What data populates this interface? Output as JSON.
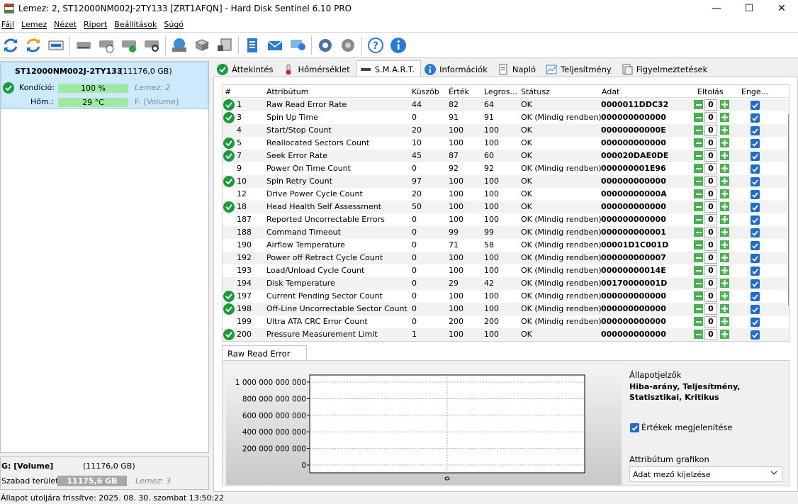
{
  "window": {
    "title": "Lemez: 2, ST12000NM002J-2TY133 [ZRT1AFQN]  -  Hard Disk Sentinel 6.10 PRO",
    "minimize": "—",
    "maximize": "☐",
    "close": "✕"
  },
  "menu": [
    "Fájl",
    "Lemez",
    "Nézet",
    "Riport",
    "Beállítások",
    "Súgó"
  ],
  "disk": {
    "name": "ST12000NM002J-2TY133",
    "size": "(11176,0 GB)",
    "health_label": "Kondíció:",
    "health_value": "100 %",
    "health_pct": 100,
    "disk_ref": "Lemez: 2",
    "temp_label": "Hőm.:",
    "temp_value": "29 °C",
    "volume_ref": "F: [Volume]"
  },
  "volume": {
    "name": "G: [Volume]",
    "size": "(11176,0 GB)",
    "free_label": "Szabad terület",
    "free_value": "11175,6 GB",
    "disk_ref": "Lemez: 3"
  },
  "status_text": "Állapot utoljára frissítve: 2025. 08. 30. szombat 13:50:22",
  "tabs": [
    "Áttekintés",
    "Hőmérséklet",
    "S.M.A.R.T.",
    "Információk",
    "Napló",
    "Teljesítmény",
    "Figyelmeztetések"
  ],
  "active_tab": 2,
  "columns": [
    "#",
    "Attribútum",
    "Küszöb",
    "Érték",
    "Legros...",
    "Státusz",
    "Adat",
    "Eltolás",
    "Enge..."
  ],
  "rows": [
    {
      "ok": true,
      "id": "1",
      "name": "Raw Read Error Rate",
      "thr": "44",
      "val": "82",
      "worst": "64",
      "status": "OK",
      "data": "0000011DDC32",
      "offset": "0"
    },
    {
      "ok": true,
      "id": "3",
      "name": "Spin Up Time",
      "thr": "0",
      "val": "91",
      "worst": "91",
      "status": "OK (Mindig rendben)",
      "data": "000000000000",
      "offset": "0"
    },
    {
      "ok": false,
      "id": "4",
      "name": "Start/Stop Count",
      "thr": "20",
      "val": "100",
      "worst": "100",
      "status": "OK",
      "data": "00000000000E",
      "offset": "0"
    },
    {
      "ok": true,
      "id": "5",
      "name": "Reallocated Sectors Count",
      "thr": "10",
      "val": "100",
      "worst": "100",
      "status": "OK",
      "data": "000000000000",
      "offset": "0"
    },
    {
      "ok": true,
      "id": "7",
      "name": "Seek Error Rate",
      "thr": "45",
      "val": "87",
      "worst": "60",
      "status": "OK",
      "data": "000020DAE0DE",
      "offset": "0"
    },
    {
      "ok": false,
      "id": "9",
      "name": "Power On Time Count",
      "thr": "0",
      "val": "92",
      "worst": "92",
      "status": "OK (Mindig rendben)",
      "data": "000000001E96",
      "offset": "0"
    },
    {
      "ok": true,
      "id": "10",
      "name": "Spin Retry Count",
      "thr": "97",
      "val": "100",
      "worst": "100",
      "status": "OK",
      "data": "000000000000",
      "offset": "0"
    },
    {
      "ok": false,
      "id": "12",
      "name": "Drive Power Cycle Count",
      "thr": "20",
      "val": "100",
      "worst": "100",
      "status": "OK",
      "data": "00000000000A",
      "offset": "0"
    },
    {
      "ok": true,
      "id": "18",
      "name": "Head Health Self Assessment",
      "thr": "50",
      "val": "100",
      "worst": "100",
      "status": "OK",
      "data": "000000000000",
      "offset": "0"
    },
    {
      "ok": false,
      "id": "187",
      "name": "Reported Uncorrectable Errors",
      "thr": "0",
      "val": "100",
      "worst": "100",
      "status": "OK (Mindig rendben)",
      "data": "000000000000",
      "offset": "0"
    },
    {
      "ok": false,
      "id": "188",
      "name": "Command Timeout",
      "thr": "0",
      "val": "99",
      "worst": "99",
      "status": "OK (Mindig rendben)",
      "data": "000000000001",
      "offset": "0"
    },
    {
      "ok": false,
      "id": "190",
      "name": "Airflow Temperature",
      "thr": "0",
      "val": "71",
      "worst": "58",
      "status": "OK (Mindig rendben)",
      "data": "00001D1C001D",
      "offset": "0"
    },
    {
      "ok": false,
      "id": "192",
      "name": "Power off Retract Cycle Count",
      "thr": "0",
      "val": "100",
      "worst": "100",
      "status": "OK (Mindig rendben)",
      "data": "000000000007",
      "offset": "0"
    },
    {
      "ok": false,
      "id": "193",
      "name": "Load/Unload Cycle Count",
      "thr": "0",
      "val": "100",
      "worst": "100",
      "status": "OK (Mindig rendben)",
      "data": "00000000014E",
      "offset": "0"
    },
    {
      "ok": false,
      "id": "194",
      "name": "Disk Temperature",
      "thr": "0",
      "val": "29",
      "worst": "42",
      "status": "OK (Mindig rendben)",
      "data": "00170000001D",
      "offset": "0"
    },
    {
      "ok": true,
      "id": "197",
      "name": "Current Pending Sector Count",
      "thr": "0",
      "val": "100",
      "worst": "100",
      "status": "OK (Mindig rendben)",
      "data": "000000000000",
      "offset": "0"
    },
    {
      "ok": true,
      "id": "198",
      "name": "Off-Line Uncorrectable Sector Count",
      "thr": "0",
      "val": "100",
      "worst": "100",
      "status": "OK (Mindig rendben)",
      "data": "000000000000",
      "offset": "0"
    },
    {
      "ok": false,
      "id": "199",
      "name": "Ultra ATA CRC Error Count",
      "thr": "0",
      "val": "200",
      "worst": "200",
      "status": "OK (Mindig rendben)",
      "data": "000000000000",
      "offset": "0"
    },
    {
      "ok": true,
      "id": "200",
      "name": "Pressure Measurement Limit",
      "thr": "1",
      "val": "100",
      "worst": "100",
      "status": "OK",
      "data": "000000000000",
      "offset": "0"
    }
  ],
  "chart_tab": "Raw Read Error Rate",
  "chart_data": {
    "type": "line",
    "title": "",
    "series": [],
    "yticks": [
      "1 000 000 000 000",
      "800 000 000 000",
      "600 000 000 000",
      "400 000 000 000",
      "200 000 000 000",
      "0"
    ],
    "ylim": [
      0,
      1000000000000
    ]
  },
  "legend_panel": {
    "heading": "Állapotjelzők",
    "flags": "Hiba-arány, Teljesítmény, Statisztikai, Kritikus",
    "show_values_label": "Értékek megjelenítése",
    "show_values_checked": true,
    "graph_label": "Attribútum grafikon",
    "graph_select": "Adat mező kijelzése"
  },
  "colors": {
    "ok_green": "#1b9a3b",
    "bar_green": "#9eeaa4",
    "selection": "#cceaff",
    "checkbox_blue": "#1f6ccc"
  }
}
